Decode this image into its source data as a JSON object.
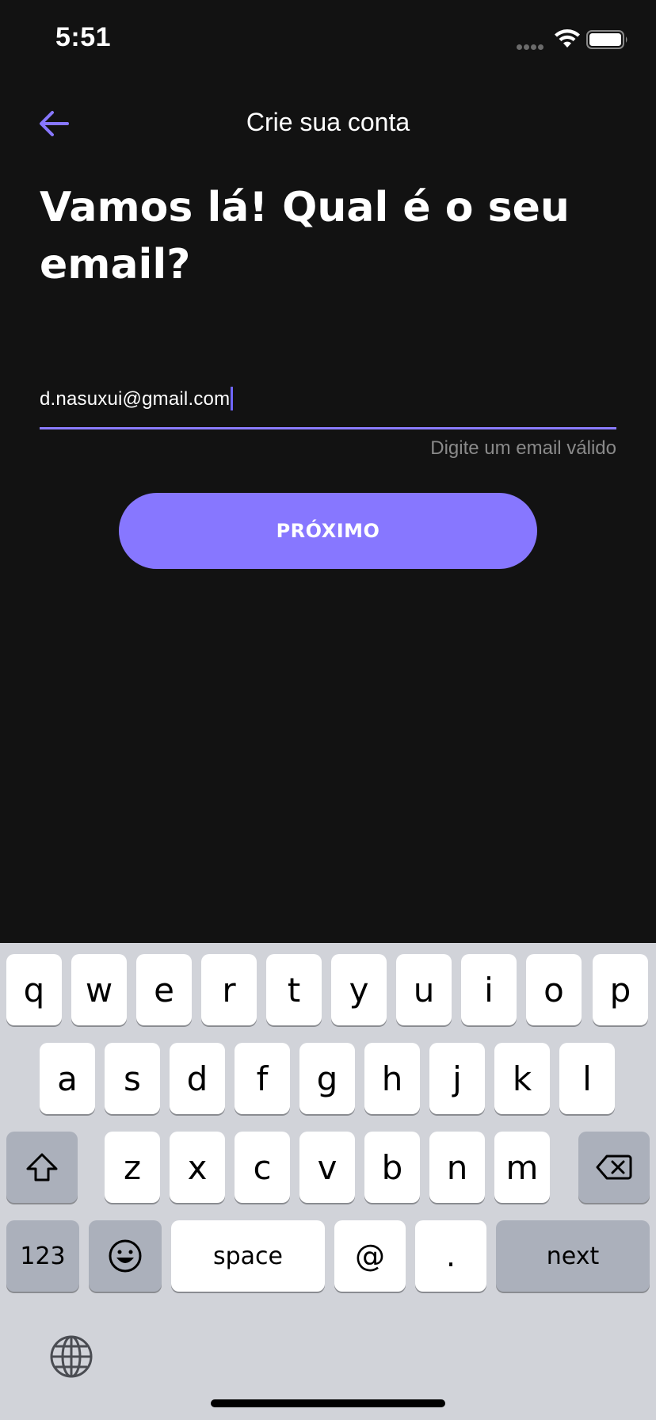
{
  "status_bar": {
    "time": "5:51"
  },
  "header": {
    "title": "Crie sua conta"
  },
  "headline": "Vamos lá! Qual é o seu email?",
  "email": {
    "value": "d.nasuxui@gmail.com",
    "helper": "Digite um email válido"
  },
  "primary_button": {
    "label": "PRÓXIMO"
  },
  "colors": {
    "background": "#121212",
    "accent": "#8777ff",
    "helper_text": "#8a8a8a",
    "keyboard_bg": "#d1d3d9"
  },
  "keyboard": {
    "row1": [
      "q",
      "w",
      "e",
      "r",
      "t",
      "y",
      "u",
      "i",
      "o",
      "p"
    ],
    "row2": [
      "a",
      "s",
      "d",
      "f",
      "g",
      "h",
      "j",
      "k",
      "l"
    ],
    "row3": [
      "z",
      "x",
      "c",
      "v",
      "b",
      "n",
      "m"
    ],
    "numbers_label": "123",
    "space_label": "space",
    "at_label": "@",
    "dot_label": ".",
    "next_label": "next",
    "icons": [
      "shift-icon",
      "delete-icon",
      "emoji-icon",
      "globe-icon"
    ]
  }
}
